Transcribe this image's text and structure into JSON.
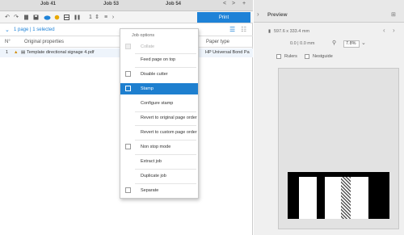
{
  "tabs": [
    {
      "label": "Job 41"
    },
    {
      "label": "Job 53"
    },
    {
      "label": "Job 54"
    }
  ],
  "tab_nav": {
    "prev": "<",
    "next": ">",
    "add": "+"
  },
  "toolbar": {
    "copies": "1",
    "print_label": "Print"
  },
  "pages": {
    "selection_text": "1 page | 1 selected"
  },
  "columns": {
    "num": "N°",
    "original": "Original properties",
    "paper": "Paper type"
  },
  "job": {
    "index": "1",
    "name": "Template directional signage 4.pdf",
    "paper": "HP Universal Bond Pa"
  },
  "menu": {
    "title": "Job options",
    "items": [
      {
        "label": "Collate",
        "checkbox": true,
        "disabled": true,
        "active": false
      },
      {
        "label": "Feed page on top",
        "checkbox": false,
        "disabled": false,
        "active": false
      },
      {
        "label": "Disable cutter",
        "checkbox": true,
        "disabled": false,
        "active": false
      },
      {
        "label": "Stamp",
        "checkbox": true,
        "disabled": false,
        "active": true
      },
      {
        "label": "Configure stamp",
        "checkbox": false,
        "disabled": false,
        "active": false
      },
      {
        "label": "Revert to original page order",
        "checkbox": false,
        "disabled": false,
        "active": false
      },
      {
        "label": "Revert to custom page order",
        "checkbox": false,
        "disabled": false,
        "active": false
      },
      {
        "label": "Non stop mode",
        "checkbox": true,
        "disabled": false,
        "active": false
      },
      {
        "label": "Extract job",
        "checkbox": false,
        "disabled": false,
        "active": false
      },
      {
        "label": "Duplicate job",
        "checkbox": false,
        "disabled": false,
        "active": false
      },
      {
        "label": "Separate",
        "checkbox": true,
        "disabled": false,
        "active": false
      }
    ]
  },
  "preview": {
    "title": "Preview",
    "media_size": "597.6 x 333.4 mm",
    "scale": "0.0 | 0.0 mm",
    "zoom": "7.8%",
    "rulers_label": "Rulers",
    "nesting_label": "Nestguide"
  },
  "colors": {
    "accent": "#1e82d7",
    "menu_active": "#1e7fcf"
  }
}
